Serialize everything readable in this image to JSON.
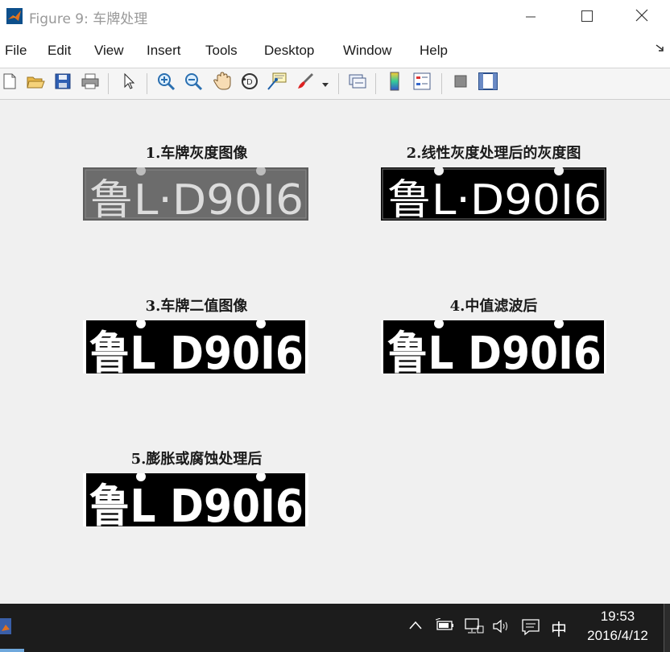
{
  "window": {
    "title": "Figure 9: 车牌处理",
    "controls": [
      "minimize",
      "maximize",
      "close"
    ]
  },
  "menu": {
    "items": [
      "File",
      "Edit",
      "View",
      "Insert",
      "Tools",
      "Desktop",
      "Window",
      "Help"
    ]
  },
  "toolbar": {
    "buttons": [
      "new-figure-icon",
      "open-file-icon",
      "save-icon",
      "print-icon",
      "edit-plot-arrow-icon",
      "zoom-in-icon",
      "zoom-out-icon",
      "pan-hand-icon",
      "rotate-3d-icon",
      "data-cursor-icon",
      "brush-icon",
      "link-plot-icon",
      "colorbar-icon",
      "legend-icon",
      "hide-plot-tools-icon",
      "show-plot-tools-icon"
    ]
  },
  "subplots": [
    {
      "title": "1.车牌灰度图像",
      "plate_text": "鲁L·D90I6",
      "style": "gray"
    },
    {
      "title": "2.线性灰度处理后的灰度图",
      "plate_text": "鲁L·D90I6",
      "style": "high-contrast"
    },
    {
      "title": "3.车牌二值图像",
      "plate_text": "鲁L D90I6",
      "style": "binary"
    },
    {
      "title": "4.中值滤波后",
      "plate_text": "鲁L D90I6",
      "style": "binary"
    },
    {
      "title": "5.膨胀或腐蚀处理后",
      "plate_text": "鲁L D90I6",
      "style": "binary"
    }
  ],
  "taskbar": {
    "tray_icons": [
      "chevron-up-icon",
      "battery-icon",
      "network-icon",
      "volume-icon",
      "notification-icon"
    ],
    "ime": "中",
    "time": "19:53",
    "date": "2016/4/12"
  }
}
